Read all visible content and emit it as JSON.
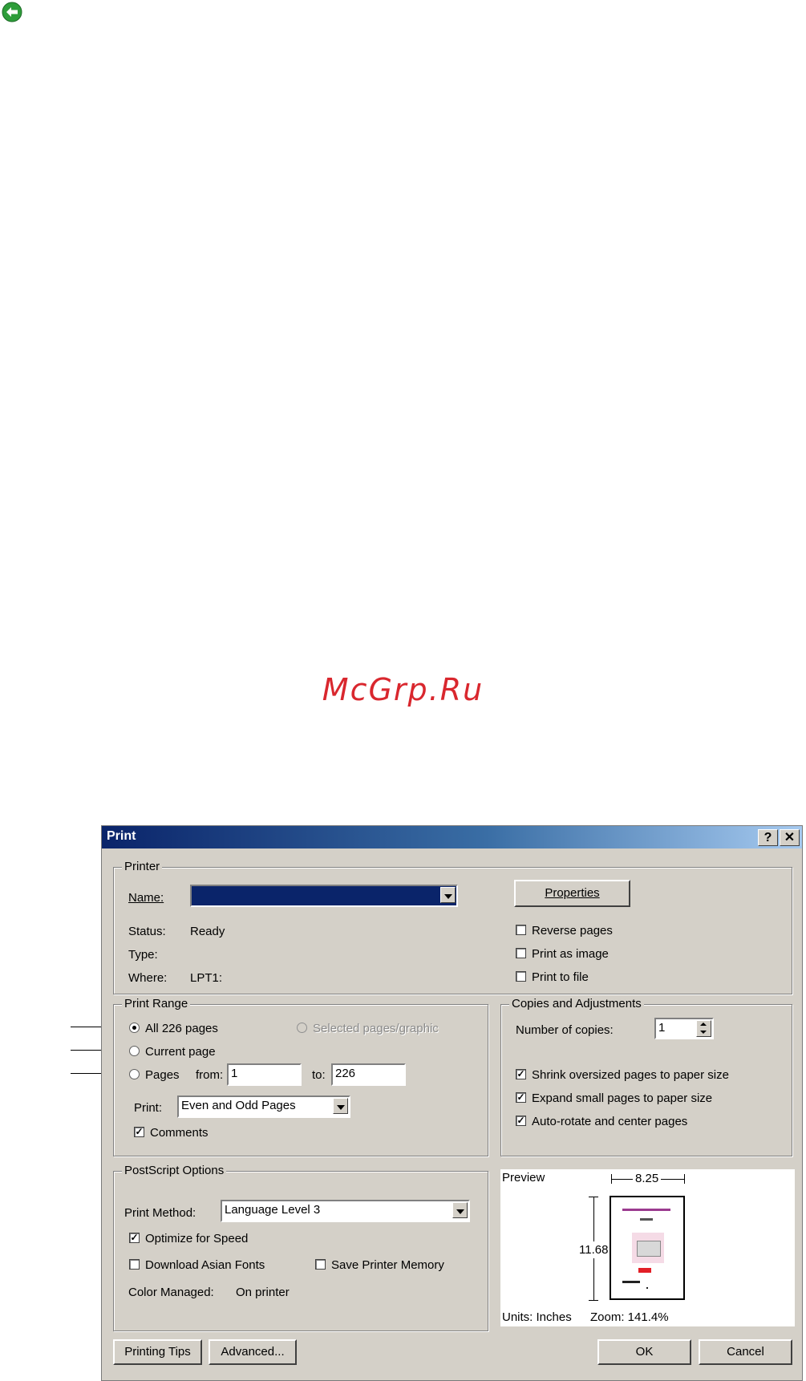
{
  "back_icon": "back-arrow-icon",
  "watermark": "McGrp.Ru",
  "dialog": {
    "title": "Print",
    "help_btn": "?",
    "close_btn": "✕",
    "printer": {
      "group_label": "Printer",
      "name_label": "Name:",
      "name_value": "",
      "properties_label": "Properties",
      "status_label": "Status:",
      "status_value": "Ready",
      "type_label": "Type:",
      "type_value": "",
      "where_label": "Where:",
      "where_value": "LPT1:",
      "reverse_pages": "Reverse pages",
      "print_as_image": "Print as image",
      "print_to_file": "Print to file"
    },
    "print_range": {
      "group_label": "Print Range",
      "all_pages": "All 226 pages",
      "selected": "Selected pages/graphic",
      "current_page": "Current page",
      "pages": "Pages",
      "from_label": "from:",
      "from_value": "1",
      "to_label": "to:",
      "to_value": "226",
      "print_label": "Print:",
      "print_value": "Even and Odd Pages",
      "comments": "Comments"
    },
    "copies": {
      "group_label": "Copies and Adjustments",
      "copies_label": "Number of copies:",
      "copies_value": "1",
      "shrink": "Shrink oversized pages to paper size",
      "expand": "Expand small pages to paper size",
      "autorotate": "Auto-rotate and center pages"
    },
    "postscript": {
      "group_label": "PostScript Options",
      "method_label": "Print Method:",
      "method_value": "Language Level 3",
      "optimize": "Optimize for Speed",
      "download_fonts": "Download Asian Fonts",
      "save_memory": "Save Printer Memory",
      "color_label": "Color Managed:",
      "color_value": "On printer"
    },
    "preview": {
      "label": "Preview",
      "width": "8.25",
      "height": "11.68",
      "units": "Units: Inches",
      "zoom": "Zoom: 141.4%"
    },
    "buttons": {
      "tips": "Printing Tips",
      "advanced": "Advanced...",
      "ok": "OK",
      "cancel": "Cancel"
    }
  }
}
